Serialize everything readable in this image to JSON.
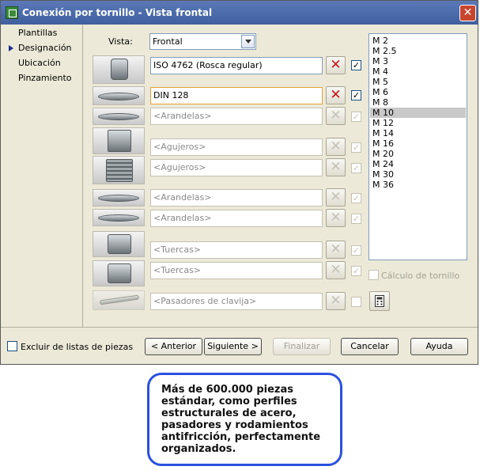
{
  "window": {
    "title": "Conexión por tornillo - Vista frontal",
    "close": "✕"
  },
  "nav": {
    "items": [
      {
        "label": "Plantillas"
      },
      {
        "label": "Designación"
      },
      {
        "label": "Ubicación"
      },
      {
        "label": "Pinzamiento"
      }
    ],
    "active": "Designación"
  },
  "vista": {
    "label": "Vista:",
    "value": "Frontal"
  },
  "rows": [
    {
      "thumb": "screw-head-icon",
      "value": "ISO 4762  (Rosca regular)",
      "delete": "✕",
      "check": "✓",
      "enabled": true
    },
    {
      "thumb": "spring-washer-icon",
      "value": "DIN 128",
      "delete": "✕",
      "check": "✓",
      "enabled": true
    },
    {
      "thumb": "washer-icon",
      "value": "<Arandelas>",
      "delete": "✕",
      "check": "✓",
      "enabled": false
    },
    {
      "thumb": "hole-icon",
      "value": "<Agujeros>",
      "delete": "✕",
      "check": "✓",
      "enabled": false
    },
    {
      "thumb": "threaded-hole-icon",
      "value": "<Agujeros>",
      "delete": "✕",
      "check": "✓",
      "enabled": false
    },
    {
      "thumb": "washer-icon",
      "value": "<Arandelas>",
      "delete": "✕",
      "check": "✓",
      "enabled": false
    },
    {
      "thumb": "washer-icon",
      "value": "<Arandelas>",
      "delete": "✕",
      "check": "✓",
      "enabled": false
    },
    {
      "thumb": "nut-icon",
      "value": "<Tuercas>",
      "delete": "✕",
      "check": "✓",
      "enabled": false
    },
    {
      "thumb": "nut-icon",
      "value": "<Tuercas>",
      "delete": "✕",
      "check": "✓",
      "enabled": false
    },
    {
      "thumb": "cotter-pin-icon",
      "value": "<Pasadores de clavija>",
      "delete": "✕",
      "check": "",
      "enabled": false
    }
  ],
  "sizes": {
    "items": [
      "M 2",
      "M 2.5",
      "M 3",
      "M 4",
      "M 5",
      "M 6",
      "M 8",
      "M 10",
      "M 12",
      "M 14",
      "M 16",
      "M 20",
      "M 24",
      "M 30",
      "M 36"
    ],
    "selected": "M 10"
  },
  "calc": {
    "label": "Cálculo de tornillo",
    "icon": "calculator-icon"
  },
  "footer": {
    "exclude_label": "Excluir de listas de piezas",
    "back": "< Anterior",
    "next": "Siguiente >",
    "finish": "Finalizar",
    "cancel": "Cancelar",
    "help": "Ayuda"
  },
  "callout": {
    "text": "Más de 600.000  piezas\nestándar, como perfiles\nestructurales de acero,\npasadores y rodamientos\nantifricción, perfectamente\norganizados."
  },
  "colors": {
    "accent": "#2b50e0",
    "title_bar": "#4a68a8",
    "delete": "#c21818",
    "selection": "#c9c9c9"
  }
}
